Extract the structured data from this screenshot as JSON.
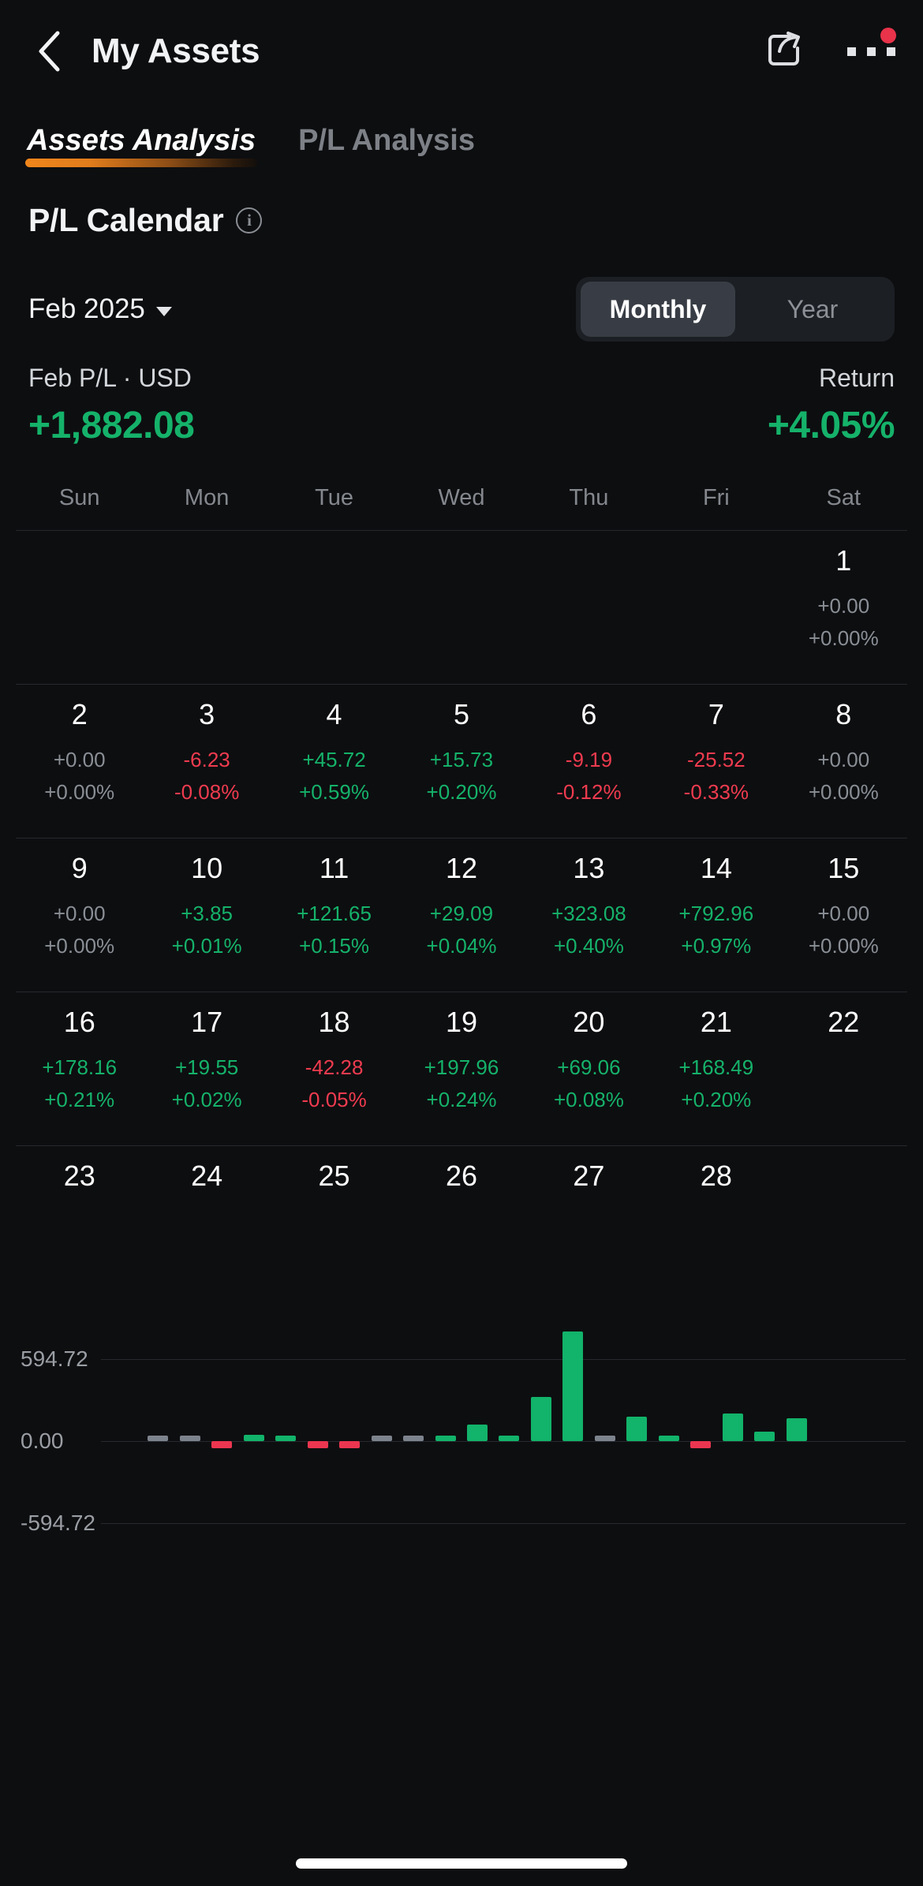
{
  "navbar": {
    "back_icon": "chevron-left-icon",
    "title": "My Assets",
    "share_icon": "share-icon",
    "more_icon": "more-horizontal-icon",
    "notification_dot_color": "#e8334a"
  },
  "tabs": [
    {
      "label": "Assets Analysis",
      "active": true
    },
    {
      "label": "P/L Analysis",
      "active": false
    }
  ],
  "section": {
    "title": "P/L Calendar",
    "info_icon": "info-circle-icon",
    "info_glyph": "i"
  },
  "controls": {
    "month_label": "Feb 2025",
    "caret_icon": "chevron-down-icon",
    "range_options": [
      {
        "label": "Monthly",
        "selected": true
      },
      {
        "label": "Year",
        "selected": false
      }
    ]
  },
  "summary": {
    "pl_label": "Feb P/L · USD",
    "pl_value": "+1,882.08",
    "return_label": "Return",
    "return_value": "+4.05%"
  },
  "calendar": {
    "weekday_headers": [
      "Sun",
      "Mon",
      "Tue",
      "Wed",
      "Thu",
      "Fri",
      "Sat"
    ],
    "weeks": [
      [
        {
          "day": "",
          "empty": true
        },
        {
          "day": "",
          "empty": true
        },
        {
          "day": "",
          "empty": true
        },
        {
          "day": "",
          "empty": true
        },
        {
          "day": "",
          "empty": true
        },
        {
          "day": "",
          "empty": true
        },
        {
          "day": "1",
          "pl": "+0.00",
          "pct": "+0.00%",
          "state": "flat"
        }
      ],
      [
        {
          "day": "2",
          "pl": "+0.00",
          "pct": "+0.00%",
          "state": "flat"
        },
        {
          "day": "3",
          "pl": "-6.23",
          "pct": "-0.08%",
          "state": "neg"
        },
        {
          "day": "4",
          "pl": "+45.72",
          "pct": "+0.59%",
          "state": "pos"
        },
        {
          "day": "5",
          "pl": "+15.73",
          "pct": "+0.20%",
          "state": "pos"
        },
        {
          "day": "6",
          "pl": "-9.19",
          "pct": "-0.12%",
          "state": "neg"
        },
        {
          "day": "7",
          "pl": "-25.52",
          "pct": "-0.33%",
          "state": "neg"
        },
        {
          "day": "8",
          "pl": "+0.00",
          "pct": "+0.00%",
          "state": "flat"
        }
      ],
      [
        {
          "day": "9",
          "pl": "+0.00",
          "pct": "+0.00%",
          "state": "flat"
        },
        {
          "day": "10",
          "pl": "+3.85",
          "pct": "+0.01%",
          "state": "pos"
        },
        {
          "day": "11",
          "pl": "+121.65",
          "pct": "+0.15%",
          "state": "pos"
        },
        {
          "day": "12",
          "pl": "+29.09",
          "pct": "+0.04%",
          "state": "pos"
        },
        {
          "day": "13",
          "pl": "+323.08",
          "pct": "+0.40%",
          "state": "pos"
        },
        {
          "day": "14",
          "pl": "+792.96",
          "pct": "+0.97%",
          "state": "pos"
        },
        {
          "day": "15",
          "pl": "+0.00",
          "pct": "+0.00%",
          "state": "flat"
        }
      ],
      [
        {
          "day": "16",
          "pl": "+178.16",
          "pct": "+0.21%",
          "state": "pos"
        },
        {
          "day": "17",
          "pl": "+19.55",
          "pct": "+0.02%",
          "state": "pos"
        },
        {
          "day": "18",
          "pl": "-42.28",
          "pct": "-0.05%",
          "state": "neg"
        },
        {
          "day": "19",
          "pl": "+197.96",
          "pct": "+0.24%",
          "state": "pos"
        },
        {
          "day": "20",
          "pl": "+69.06",
          "pct": "+0.08%",
          "state": "pos"
        },
        {
          "day": "21",
          "pl": "+168.49",
          "pct": "+0.20%",
          "state": "pos"
        },
        {
          "day": "22",
          "pl": "",
          "pct": "",
          "state": "none"
        }
      ],
      [
        {
          "day": "23",
          "pl": "",
          "pct": "",
          "state": "none"
        },
        {
          "day": "24",
          "pl": "",
          "pct": "",
          "state": "none"
        },
        {
          "day": "25",
          "pl": "",
          "pct": "",
          "state": "none"
        },
        {
          "day": "26",
          "pl": "",
          "pct": "",
          "state": "none"
        },
        {
          "day": "27",
          "pl": "",
          "pct": "",
          "state": "none"
        },
        {
          "day": "28",
          "pl": "",
          "pct": "",
          "state": "none"
        },
        {
          "day": "",
          "empty": true
        }
      ]
    ]
  },
  "chart_data": {
    "type": "bar",
    "title": "",
    "xlabel": "",
    "ylabel": "",
    "grid": true,
    "legend": "none",
    "ylim": [
      -594.72,
      594.72
    ],
    "yticks": [
      594.72,
      0.0,
      -594.72
    ],
    "ytick_labels": [
      "594.72",
      "0.00",
      "-594.72"
    ],
    "categories": [
      "1",
      "2",
      "3",
      "4",
      "5",
      "6",
      "7",
      "8",
      "9",
      "10",
      "11",
      "12",
      "13",
      "14",
      "15",
      "16",
      "17",
      "18",
      "19",
      "20",
      "21"
    ],
    "values": [
      0.0,
      0.0,
      -6.23,
      45.72,
      15.73,
      -9.19,
      -25.52,
      0.0,
      0.0,
      3.85,
      121.65,
      29.09,
      323.08,
      792.96,
      0.0,
      178.16,
      19.55,
      -42.28,
      197.96,
      69.06,
      168.49
    ],
    "colors": {
      "positive": "#12b36a",
      "negative": "#ec3650",
      "zero": "#7d838d"
    }
  },
  "colors": {
    "background": "#0d0e10",
    "accent": "#f0861b",
    "positive": "#15b26a",
    "negative": "#ef3b4f",
    "neutral": "#8a8f96"
  }
}
